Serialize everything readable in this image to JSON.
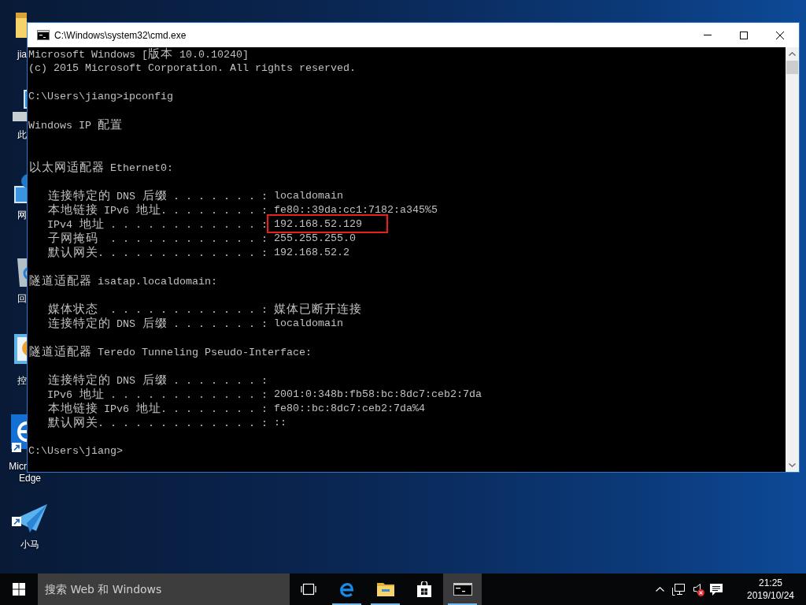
{
  "desktop": {
    "icons": [
      {
        "kind": "folder",
        "label_lines": [
          "jia"
        ],
        "shortcut": false
      },
      {
        "kind": "computer",
        "label_lines": [
          "此"
        ],
        "shortcut": false
      },
      {
        "kind": "network",
        "label_lines": [
          "网"
        ],
        "shortcut": false
      },
      {
        "kind": "recycle-bin",
        "label_lines": [
          "回"
        ],
        "shortcut": false
      },
      {
        "kind": "control-panel",
        "label_lines": [
          "控"
        ],
        "shortcut": false
      },
      {
        "kind": "browser",
        "label_lines": [
          "Micr",
          "Edge"
        ],
        "shortcut": true
      },
      {
        "kind": "paper-plane",
        "label_lines": [
          "小马"
        ],
        "shortcut": true
      }
    ]
  },
  "window": {
    "title": "C:\\Windows\\system32\\cmd.exe",
    "console": {
      "banner": [
        "Microsoft Windows [版本 10.0.10240]",
        "(c) 2015 Microsoft Corporation. All rights reserved."
      ],
      "command_line": "C:\\Users\\jiang>ipconfig",
      "heading": "Windows IP 配置",
      "adapters": [
        {
          "title": "以太网适配器 Ethernet0:",
          "entries": [
            {
              "label": "连接特定的 DNS 后缀 . . . . . . . :",
              "value": "localdomain",
              "highlighted": false
            },
            {
              "label": "本地链接 IPv6 地址. . . . . . . . :",
              "value": "fe80::39da:cc1:7182:a345%5",
              "highlighted": false
            },
            {
              "label": "IPv4 地址 . . . . . . . . . . . . :",
              "value": "192.168.52.129",
              "highlighted": true
            },
            {
              "label": "子网掩码  . . . . . . . . . . . . :",
              "value": "255.255.255.0",
              "highlighted": false
            },
            {
              "label": "默认网关. . . . . . . . . . . . . :",
              "value": "192.168.52.2",
              "highlighted": false
            }
          ]
        },
        {
          "title": "隧道适配器 isatap.localdomain:",
          "entries": [
            {
              "label": "媒体状态  . . . . . . . . . . . . :",
              "value": "媒体已断开连接",
              "highlighted": false
            },
            {
              "label": "连接特定的 DNS 后缀 . . . . . . . :",
              "value": "localdomain",
              "highlighted": false
            }
          ]
        },
        {
          "title": "隧道适配器 Teredo Tunneling Pseudo-Interface:",
          "entries": [
            {
              "label": "连接特定的 DNS 后缀 . . . . . . . :",
              "highlighted": false
            },
            {
              "label": "IPv6 地址 . . . . . . . . . . . . :",
              "value": "2001:0:348b:fb58:bc:8dc7:ceb2:7da",
              "highlighted": false
            },
            {
              "label": "本地链接 IPv6 地址. . . . . . . . :",
              "value": "fe80::bc:8dc7:ceb2:7da%4",
              "highlighted": false
            },
            {
              "label": "默认网关. . . . . . . . . . . . . :",
              "value": "::",
              "highlighted": false
            }
          ]
        }
      ],
      "prompt": "C:\\Users\\jiang>"
    }
  },
  "taskbar": {
    "search": {
      "placeholder": "搜索 Web 和 Windows"
    },
    "apps": [
      {
        "kind": "browser",
        "running": true,
        "selected": false
      },
      {
        "kind": "folder",
        "running": true,
        "selected": false
      },
      {
        "kind": "store",
        "running": false,
        "selected": false
      },
      {
        "kind": "console",
        "running": true,
        "selected": true
      }
    ],
    "tray": {
      "volume": {
        "muted": true
      },
      "time": "21:25",
      "date": "2019/10/24"
    }
  }
}
